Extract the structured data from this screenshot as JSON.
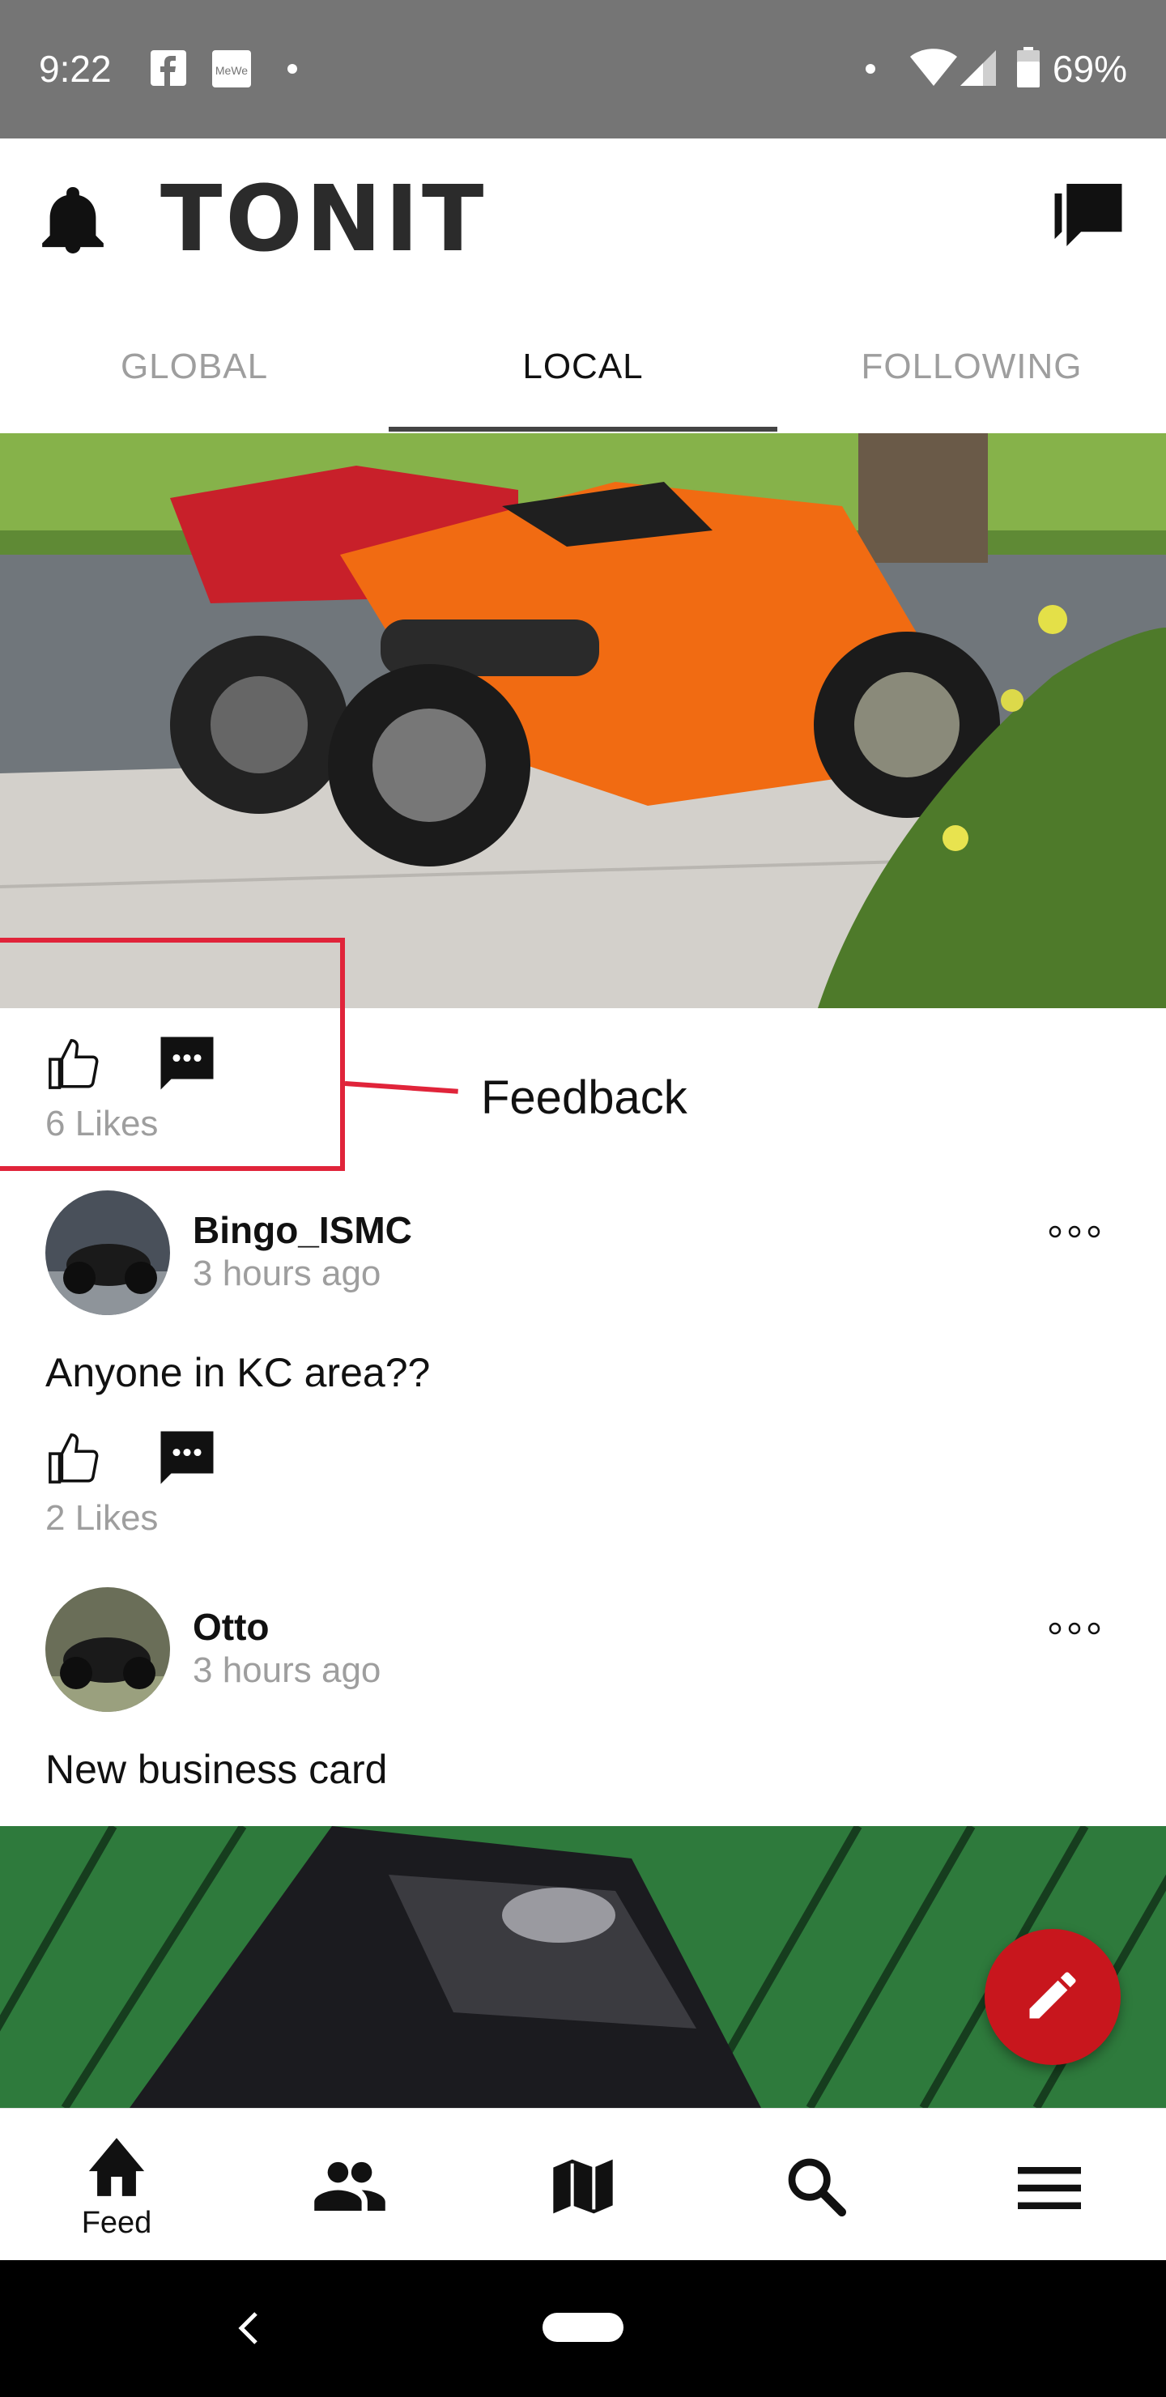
{
  "status_bar": {
    "time": "9:22",
    "battery": "69%",
    "notification_icons": [
      "facebook-icon",
      "mewe-icon",
      "dot-icon"
    ],
    "system_icons": [
      "dot-icon",
      "wifi-icon",
      "signal-icon",
      "battery-icon"
    ]
  },
  "header": {
    "logo": "TONIT",
    "left_icon": "bell-icon",
    "right_icon": "chat-icon"
  },
  "tabs": [
    {
      "label": "GLOBAL",
      "active": false
    },
    {
      "label": "LOCAL",
      "active": true
    },
    {
      "label": "FOLLOWING",
      "active": false
    }
  ],
  "first_post": {
    "image": "orange-motorcycle-photo",
    "likes": "6 Likes"
  },
  "annotation": {
    "label": "Feedback",
    "color": "#e0243a"
  },
  "posts": [
    {
      "username": "Bingo_ISMC",
      "time": "3 hours ago",
      "text": "Anyone in KC area??",
      "likes": "2 Likes"
    },
    {
      "username": "Otto",
      "time": "3 hours ago",
      "text": "New business card",
      "image": "business-card-photo"
    }
  ],
  "fab": {
    "icon": "pencil-icon",
    "color": "#c8161d"
  },
  "bottom_nav": [
    {
      "icon": "home-icon",
      "label": "Feed"
    },
    {
      "icon": "people-icon",
      "label": ""
    },
    {
      "icon": "map-icon",
      "label": ""
    },
    {
      "icon": "search-icon",
      "label": ""
    },
    {
      "icon": "menu-icon",
      "label": ""
    }
  ],
  "colors": {
    "status_bar": "#757575",
    "accent": "#c8161d",
    "muted_text": "#9e9e9e"
  }
}
